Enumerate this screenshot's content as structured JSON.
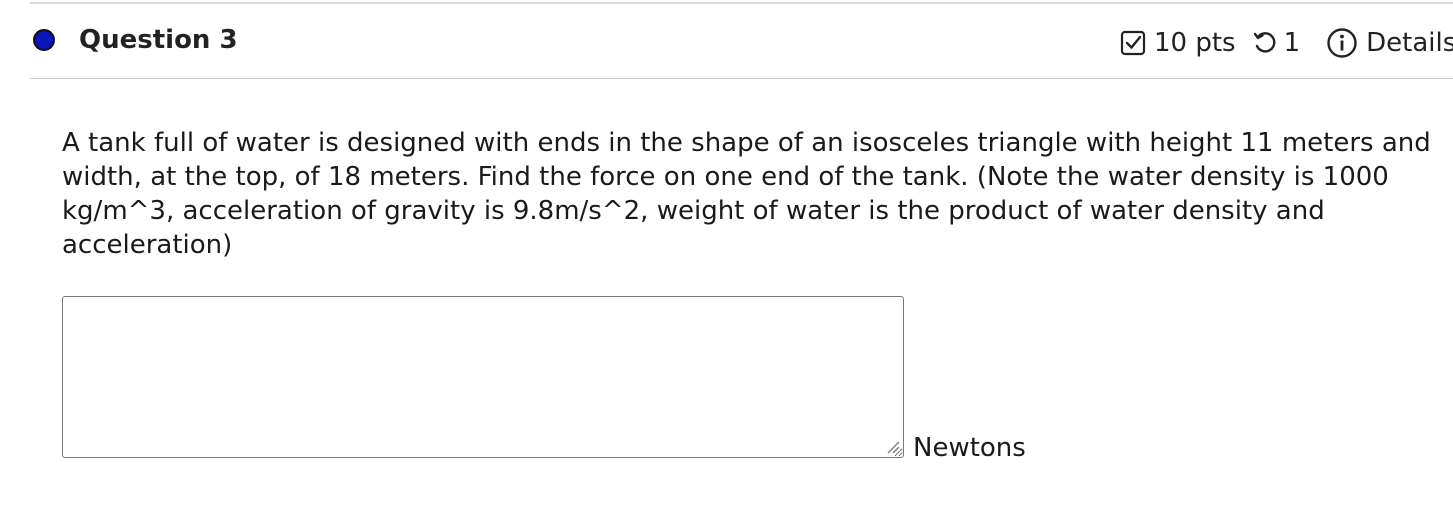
{
  "question": {
    "title": "Question 3",
    "status_color": "#0a16b8",
    "points_label": "10 pts",
    "attempts": "1",
    "details_label": "Details",
    "text": "A tank full of water is designed with ends in the shape of an isosceles triangle with height 11 meters and width, at the top, of 18 meters. Find the force on one end of the tank. (Note the water density is 1000 kg/m^3, acceleration of gravity is 9.8m/s^2, weight of water is the product of water density and acceleration)",
    "answer_value": "",
    "unit": "Newtons"
  },
  "icons": {
    "status": "filled-circle-icon",
    "points": "checkbox-check-icon",
    "attempts": "undo-arrow-icon",
    "details": "info-circle-icon",
    "resize": "resize-grip-icon"
  }
}
